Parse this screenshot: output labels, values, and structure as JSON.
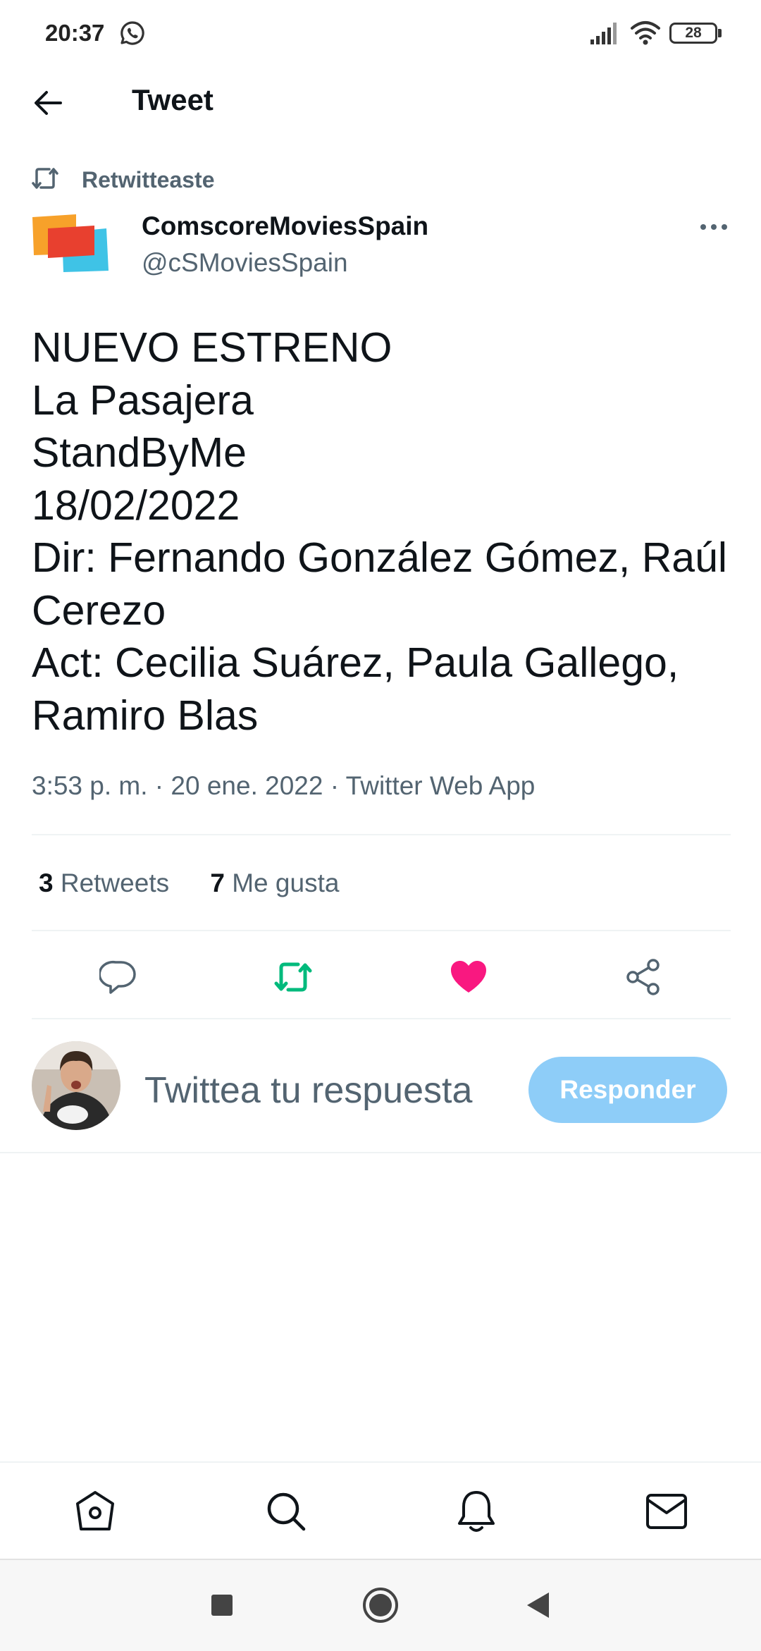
{
  "status_bar": {
    "time": "20:37",
    "battery_level": "28",
    "icons": [
      "whatsapp-icon",
      "signal-icon",
      "wifi-icon",
      "battery-icon"
    ]
  },
  "header": {
    "title": "Tweet",
    "back_icon": "arrow-left-icon"
  },
  "tweet": {
    "retweet_context": "Retwitteaste",
    "author": {
      "name": "ComscoreMoviesSpain",
      "handle": "@cSMoviesSpain"
    },
    "body_lines": [
      "NUEVO ESTRENO",
      "La Pasajera",
      "StandByMe",
      "18/02/2022",
      "Dir: Fernando González Gómez, Raúl",
      "Cerezo",
      "Act: Cecilia Suárez, Paula Gallego,",
      "Ramiro Blas"
    ],
    "meta": "3:53 p. m. · 20 ene. 2022 · Twitter Web App",
    "stats": {
      "retweets_count": "3",
      "retweets_label": "Retweets",
      "likes_count": "7",
      "likes_label": "Me gusta"
    },
    "actions": [
      "reply-icon",
      "retweet-icon",
      "heart-icon",
      "share-icon"
    ],
    "retweeted": true,
    "liked": true
  },
  "reply_composer": {
    "placeholder": "Twittea tu respuesta",
    "submit_label": "Responder"
  },
  "bottom_nav": [
    "home-icon",
    "search-icon",
    "bell-icon",
    "mail-icon"
  ],
  "system_nav": [
    "recents-button",
    "home-button",
    "back-button"
  ],
  "colors": {
    "text_primary": "#0f1419",
    "text_secondary": "#536471",
    "retweet_green": "#00ba7c",
    "like_pink": "#f91880",
    "reply_button_disabled": "#8ecdf8",
    "divider": "#eff3f4"
  }
}
